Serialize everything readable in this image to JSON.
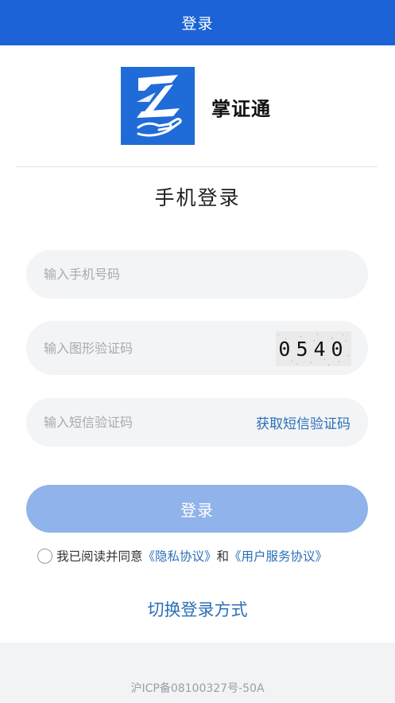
{
  "header": {
    "title": "登录"
  },
  "brand": {
    "app_name": "掌证通",
    "logo_icon": "hand-z-logo-icon",
    "logo_bg": "#1f6bd8"
  },
  "page_title": "手机登录",
  "form": {
    "phone": {
      "placeholder": "输入手机号码",
      "value": ""
    },
    "captcha": {
      "placeholder": "输入图形验证码",
      "value": "",
      "image_text": "0540"
    },
    "sms": {
      "placeholder": "输入短信验证码",
      "value": "",
      "get_code_label": "获取短信验证码"
    }
  },
  "login_button": {
    "label": "登录",
    "color": "#8fb3ea"
  },
  "agreement": {
    "checked": false,
    "prefix": "我已阅读并同意",
    "privacy_link": "《隐私协议》",
    "and": "和",
    "terms_link": "《用户服务协议》"
  },
  "switch_login": {
    "label": "切换登录方式"
  },
  "footer": {
    "icp": "沪ICP备08100327号-50A"
  },
  "colors": {
    "primary": "#1b63d6",
    "link": "#2a6fb8",
    "field_bg": "#f3f4f6"
  }
}
